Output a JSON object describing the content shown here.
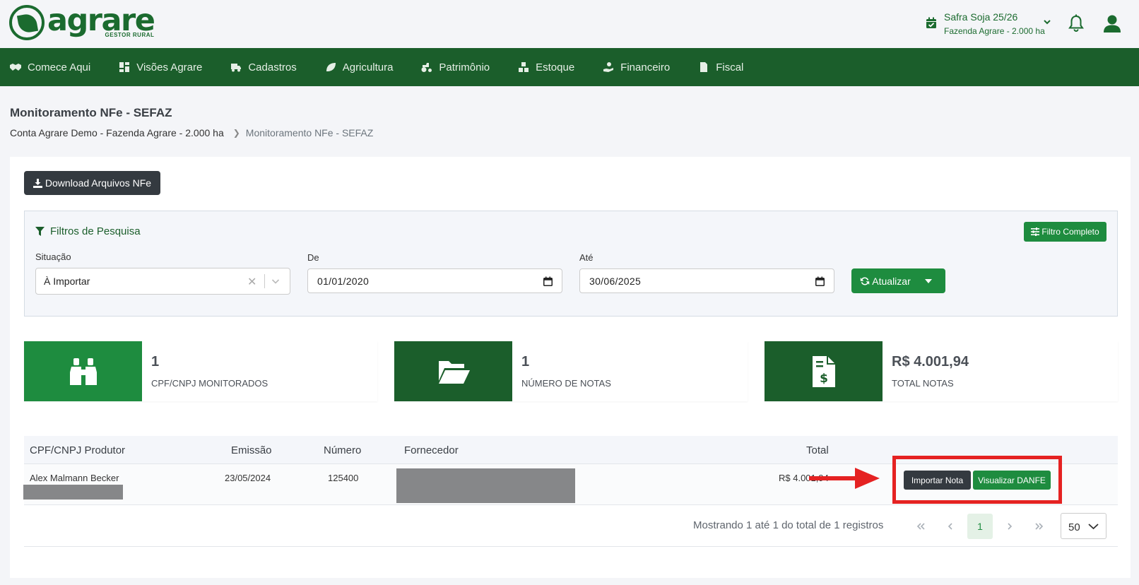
{
  "brand": {
    "name": "agrare",
    "tagline": "GESTOR RURAL",
    "color": "#1b6b2f"
  },
  "header": {
    "safra_title": "Safra Soja 25/26",
    "safra_subtitle": "Fazenda Agrare - 2.000 ha"
  },
  "nav": {
    "bg_color": "#1b5e2b",
    "items": [
      {
        "label": "Comece Aqui",
        "icon": "handshake-icon"
      },
      {
        "label": "Visões Agrare",
        "icon": "dashboard-icon"
      },
      {
        "label": "Cadastros",
        "icon": "truck-icon"
      },
      {
        "label": "Agricultura",
        "icon": "leaf-icon"
      },
      {
        "label": "Patrimônio",
        "icon": "tractor-icon"
      },
      {
        "label": "Estoque",
        "icon": "boxes-icon"
      },
      {
        "label": "Financeiro",
        "icon": "hand-coin-icon"
      },
      {
        "label": "Fiscal",
        "icon": "invoice-icon"
      }
    ]
  },
  "page": {
    "title": "Monitoramento NFe - SEFAZ",
    "breadcrumb": [
      "Conta Agrare Demo - Fazenda Agrare - 2.000 ha",
      "Monitoramento NFe - SEFAZ"
    ]
  },
  "actions": {
    "download_label": "Download Arquivos NFe"
  },
  "filters": {
    "title": "Filtros de Pesquisa",
    "full_filter_label": "Filtro Completo",
    "situacao_label": "Situação",
    "situacao_value": "À Importar",
    "de_label": "De",
    "de_value": "01/01/2020",
    "ate_label": "Até",
    "ate_value": "30/06/2025",
    "update_label": "Atualizar"
  },
  "stats": [
    {
      "value": "1",
      "label": "CPF/CNPJ MONITORADOS",
      "icon": "binoculars-icon",
      "color": "#1e8c3f"
    },
    {
      "value": "1",
      "label": "NÚMERO DE NOTAS",
      "icon": "folder-open-icon",
      "color": "#1b5e2b"
    },
    {
      "value": "R$ 4.001,94",
      "label": "TOTAL NOTAS",
      "icon": "invoice-dollar-icon",
      "color": "#1b5e2b"
    }
  ],
  "table": {
    "columns": [
      "CPF/CNPJ Produtor",
      "Emissão",
      "Número",
      "Fornecedor",
      "Total"
    ],
    "rows": [
      {
        "produtor": "Alex Malmann Becker",
        "emissao": "23/05/2024",
        "numero": "125400",
        "fornecedor": "",
        "total": "R$ 4.001,94"
      }
    ],
    "row_actions": {
      "import_label": "Importar Nota",
      "view_label": "Visualizar DANFE"
    }
  },
  "pagination": {
    "info": "Mostrando 1 até 1 do total de 1 registros",
    "current_page": "1",
    "per_page": "50"
  },
  "annotation": {
    "highlight_color": "#e52222"
  }
}
